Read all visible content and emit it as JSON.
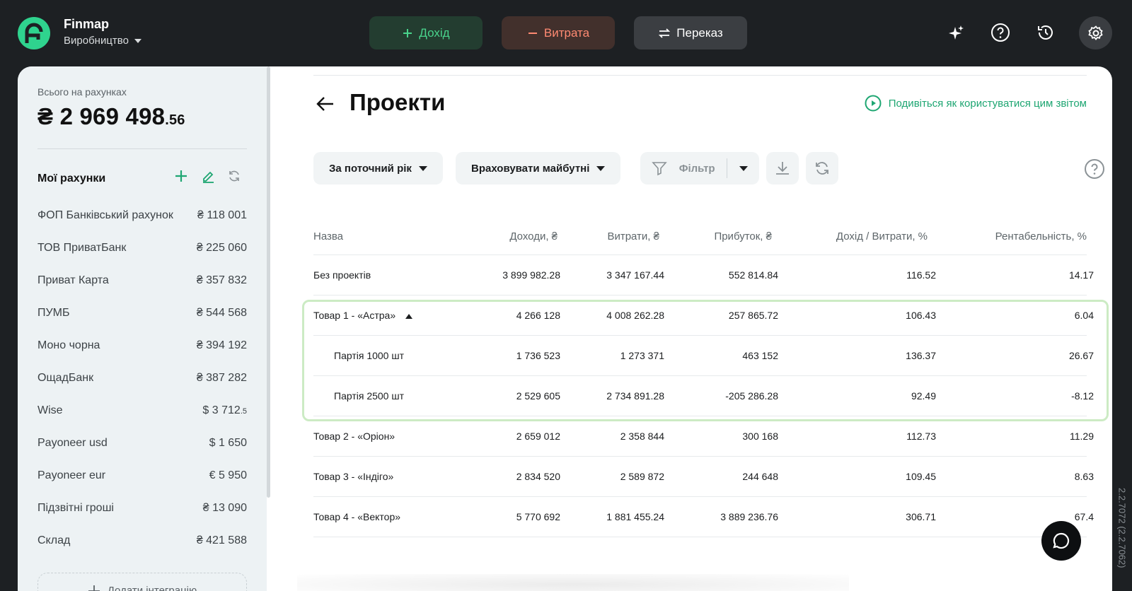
{
  "brand": {
    "name": "Finmap",
    "workspace": "Виробництво"
  },
  "topbar": {
    "income_label": "Дохід",
    "expense_label": "Витрата",
    "transfer_label": "Переказ"
  },
  "sidebar": {
    "total_label": "Всього на рахунках",
    "total_main": "₴ 2 969 498",
    "total_cents": ".56",
    "accounts_title": "Мої рахунки",
    "accounts": [
      {
        "name": "ФОП Банківський рахунок",
        "amount": "₴ 118 001",
        "fraction": ""
      },
      {
        "name": "ТОВ ПриватБанк",
        "amount": "₴ 225 060",
        "fraction": ""
      },
      {
        "name": "Приват Карта",
        "amount": "₴ 357 832",
        "fraction": ""
      },
      {
        "name": "ПУМБ",
        "amount": "₴ 544 568",
        "fraction": ""
      },
      {
        "name": "Моно чорна",
        "amount": "₴ 394 192",
        "fraction": ""
      },
      {
        "name": "ОщадБанк",
        "amount": "₴ 387 282",
        "fraction": ""
      },
      {
        "name": "Wise",
        "amount": "$  3 712",
        "fraction": ".5"
      },
      {
        "name": "Payoneer usd",
        "amount": "$  1 650",
        "fraction": ""
      },
      {
        "name": "Payoneer eur",
        "amount": "€ 5 950",
        "fraction": ""
      },
      {
        "name": "Підзвітні гроші",
        "amount": "₴ 13 090",
        "fraction": ""
      },
      {
        "name": "Склад",
        "amount": "₴ 421 588",
        "fraction": ""
      }
    ],
    "add_integration_label": "Додати інтеграцію"
  },
  "content": {
    "title": "Проекти",
    "video_link": "Подивіться як користуватися цим звітом",
    "filters": {
      "period": "За поточний рік",
      "future": "Враховувати майбутні",
      "filter": "Фільтр"
    },
    "table": {
      "headers": [
        "Назва",
        "Доходи, ₴",
        "Витрати, ₴",
        "Прибуток, ₴",
        "Дохід / Витрати, %",
        "Рентабельність, %"
      ],
      "rows": [
        {
          "name": "Без проектів",
          "income": "3 899 982.28",
          "expense": "3 347 167.44",
          "profit": "552 814.84",
          "ratio": "116.52",
          "margin": "14.17"
        },
        {
          "name": "Товар 1 - «Астра»",
          "income": "4 266 128",
          "expense": "4 008 262.28",
          "profit": "257 865.72",
          "ratio": "106.43",
          "margin": "6.04"
        },
        {
          "name": "Партія 1000 шт",
          "income": "1 736 523",
          "expense": "1 273 371",
          "profit": "463 152",
          "ratio": "136.37",
          "margin": "26.67"
        },
        {
          "name": "Партія 2500 шт",
          "income": "2 529 605",
          "expense": "2 734 891.28",
          "profit": "-205 286.28",
          "ratio": "92.49",
          "margin": "-8.12"
        },
        {
          "name": "Товар 2 - «Оріон»",
          "income": "2 659 012",
          "expense": "2 358 844",
          "profit": "300 168",
          "ratio": "112.73",
          "margin": "11.29"
        },
        {
          "name": "Товар 3 - «Індіго»",
          "income": "2 834 520",
          "expense": "2 589 872",
          "profit": "244 648",
          "ratio": "109.45",
          "margin": "8.63"
        },
        {
          "name": "Товар 4 - «Вектор»",
          "income": "5 770 692",
          "expense": "1 881 455.24",
          "profit": "3 889 236.76",
          "ratio": "306.71",
          "margin": "67.4"
        }
      ]
    }
  },
  "version": "2.2.7072 (2.2.7062)",
  "colors": {
    "income": "#49d38c",
    "expense": "#ff8a72",
    "accent": "#1ea672",
    "highlight_border": "#ccebc4"
  },
  "icons": [
    "logo-icon",
    "plus-icon",
    "minus-icon",
    "transfer-icon",
    "sparkle-icon",
    "help-icon",
    "history-icon",
    "gear-icon",
    "edit-icon",
    "refresh-icon",
    "arrow-left-icon",
    "play-icon",
    "funnel-icon",
    "download-icon",
    "chat-icon"
  ]
}
